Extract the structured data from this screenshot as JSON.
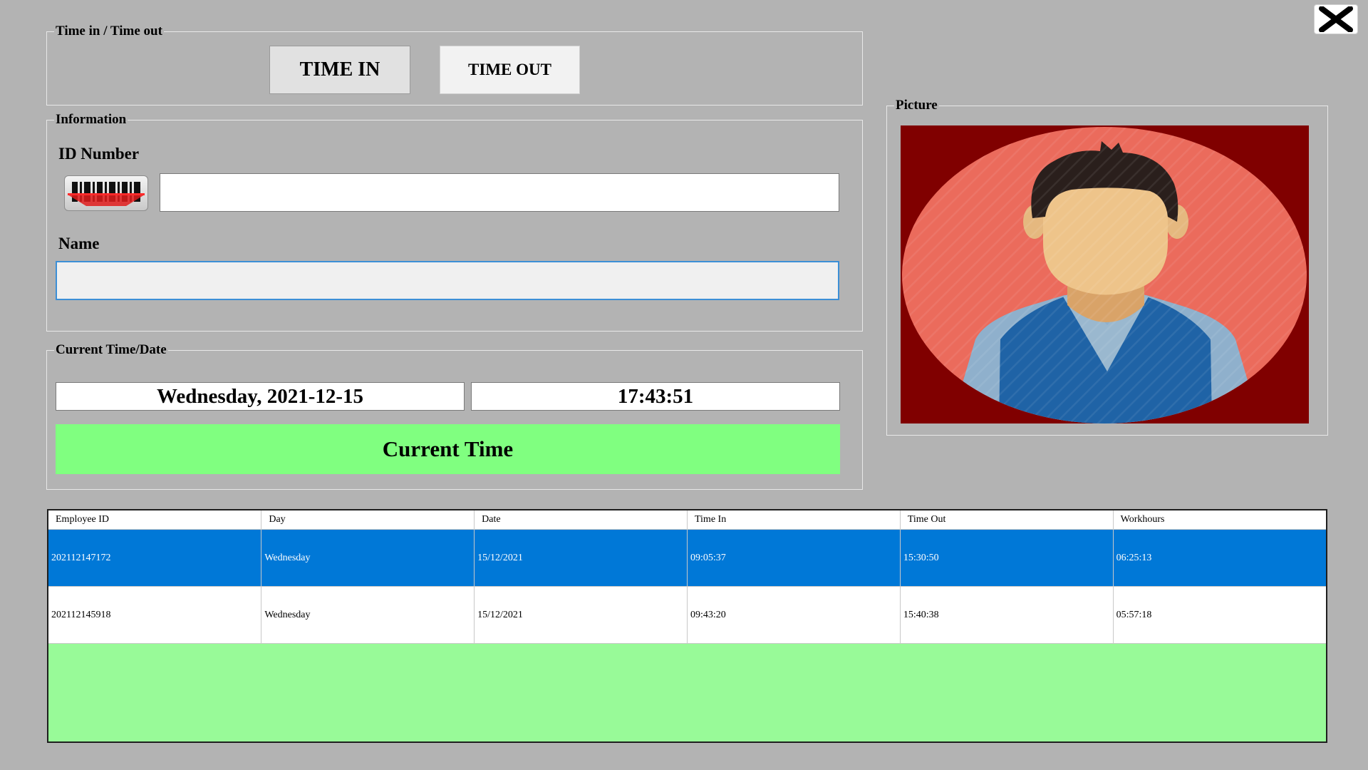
{
  "close_button": {
    "icon": "close-icon"
  },
  "timeinout": {
    "legend": "Time in / Time out",
    "time_in_label": "TIME IN",
    "time_out_label": "TIME OUT"
  },
  "information": {
    "legend": "Information",
    "id_label": "ID Number",
    "id_value": "",
    "barcode_icon": "barcode-scanner-icon",
    "name_label": "Name",
    "name_value": ""
  },
  "current": {
    "legend": "Current Time/Date",
    "date": "Wednesday, 2021-12-15",
    "time": "17:43:51",
    "button_label": "Current Time"
  },
  "picture": {
    "legend": "Picture",
    "image": "employee-avatar"
  },
  "colors": {
    "background": "#b3b3b3",
    "current_time_button": "#80ff80",
    "grid_background": "#98fa98",
    "selected_row": "#0078d7",
    "picture_background": "#800000",
    "avatar_circle": "#eb6b5c"
  },
  "table": {
    "columns": [
      "Employee ID",
      "Day",
      "Date",
      "Time In",
      "Time Out",
      "Workhours"
    ],
    "rows": [
      {
        "selected": true,
        "cells": [
          "202112147172",
          "Wednesday",
          "15/12/2021",
          "09:05:37",
          "15:30:50",
          "06:25:13"
        ]
      },
      {
        "selected": false,
        "cells": [
          "202112145918",
          "Wednesday",
          "15/12/2021",
          "09:43:20",
          "15:40:38",
          "05:57:18"
        ]
      }
    ]
  }
}
